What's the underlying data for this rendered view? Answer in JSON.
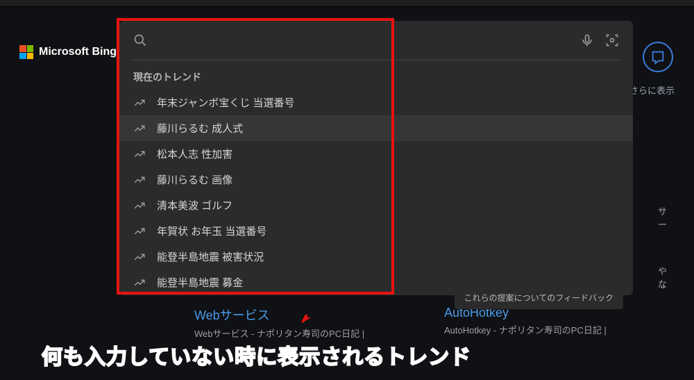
{
  "logo_text": "Microsoft Bing",
  "more_link": "さらに表示",
  "search": {
    "value": "",
    "placeholder": ""
  },
  "trends_header": "現在のトレンド",
  "trends": [
    "年末ジャンボ宝くじ 当選番号",
    "藤川らるむ 成人式",
    "松本人志 性加害",
    "藤川らるむ 画像",
    "清本美波 ゴルフ",
    "年賀状 お年玉 当選番号",
    "能登半島地震 被害状況",
    "能登半島地震 募金"
  ],
  "hover_index": 1,
  "feedback_label": "これらの提案についてのフィードバック",
  "bg": {
    "frag1": "サー",
    "frag2": "やな",
    "frag3": "...",
    "left_title": "Webサービス",
    "left_desc": "Webサービス - ナポリタン寿司のPC日記 |",
    "right_title": "AutoHotkey",
    "right_desc": "AutoHotkey - ナポリタン寿司のPC日記 |"
  },
  "annotation": "何も入力していない時に表示されるトレンド"
}
